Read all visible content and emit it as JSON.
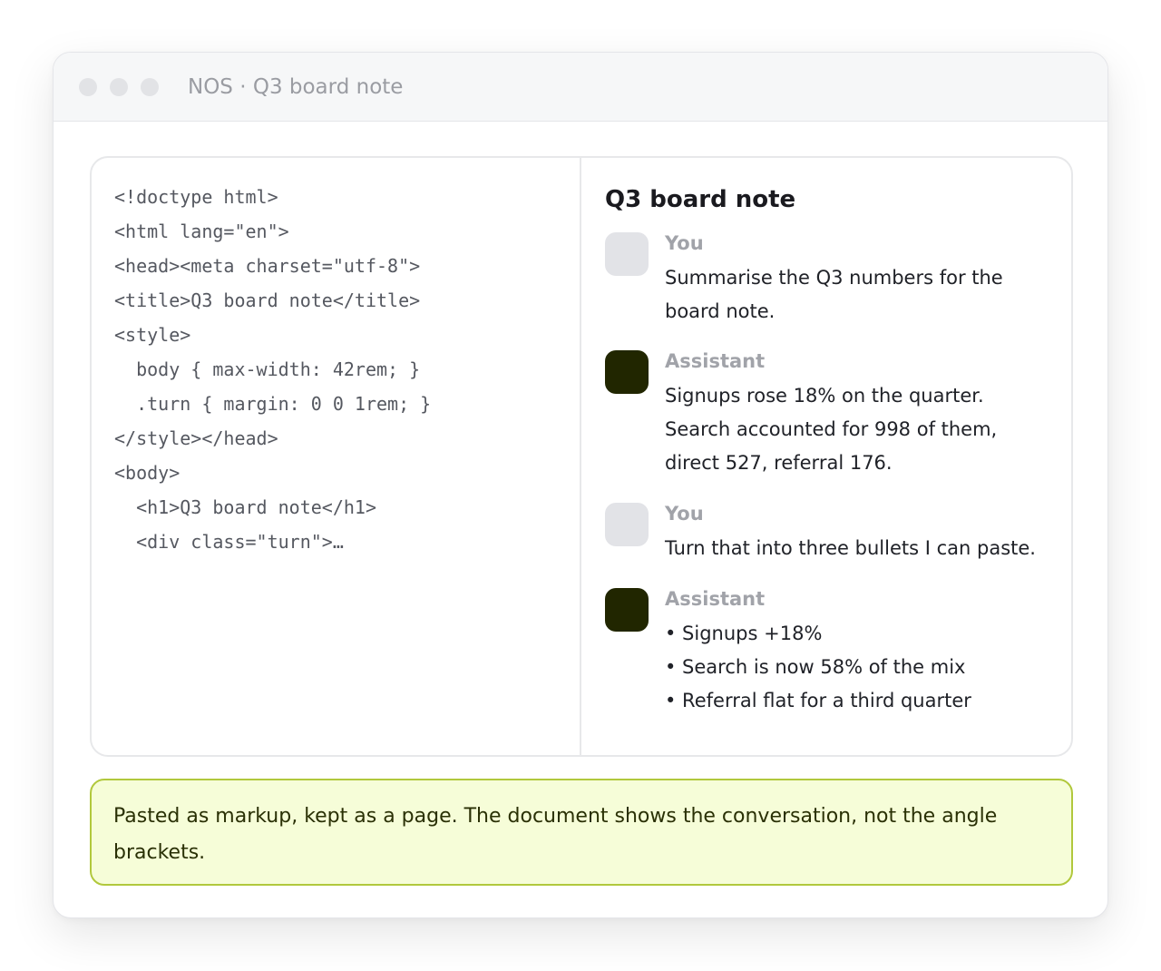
{
  "window": {
    "title": "NOS · Q3 board note"
  },
  "source": {
    "lines": [
      "<!doctype html>",
      "<html lang=\"en\">",
      "<head><meta charset=\"utf-8\">",
      "<title>Q3 board note</title>",
      "<style>",
      "  body { max-width: 42rem; }",
      "  .turn { margin: 0 0 1rem; }",
      "</style></head>",
      "<body>",
      "  <h1>Q3 board note</h1>",
      "  <div class=\"turn\">…"
    ]
  },
  "preview": {
    "title": "Q3 board note",
    "turns": [
      {
        "speaker": "You",
        "avatar_color": "#e2e3e7",
        "lines": [
          "Summarise the Q3 numbers for the",
          "board note."
        ]
      },
      {
        "speaker": "Assistant",
        "avatar_color": "#212600",
        "lines": [
          "Signups rose 18% on the quarter.",
          "Search accounted for 998 of them,",
          "direct 527, referral 176."
        ]
      },
      {
        "speaker": "You",
        "avatar_color": "#e2e3e7",
        "lines": [
          "Turn that into three bullets I can paste."
        ]
      },
      {
        "speaker": "Assistant",
        "avatar_color": "#212600",
        "lines": [
          "• Signups +18%",
          "• Search is now 58% of the mix",
          "• Referral flat for a third quarter"
        ]
      }
    ]
  },
  "note": {
    "text": "Pasted as markup, kept as a page. The document shows the conversation, not the angle brackets."
  }
}
